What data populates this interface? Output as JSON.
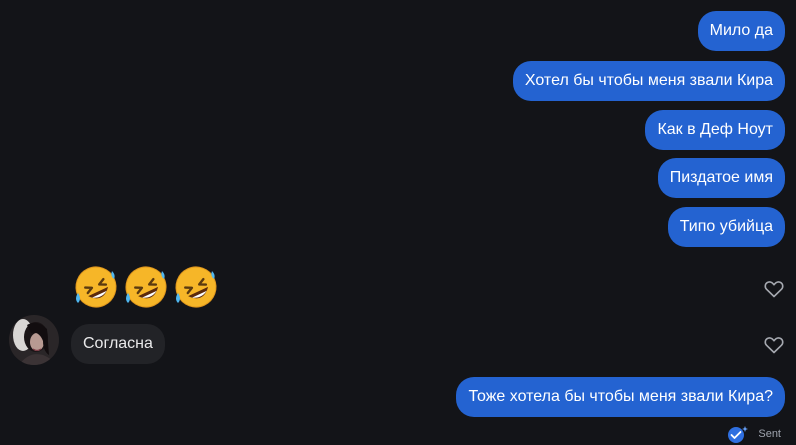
{
  "outgoing_messages": [
    {
      "text": "Мило да"
    },
    {
      "text": "Хотел бы чтобы меня звали Кира"
    },
    {
      "text": "Как в Деф Ноут"
    },
    {
      "text": "Пиздатое имя"
    },
    {
      "text": "Типо убийца"
    }
  ],
  "reaction_message": {
    "emoji_count": 3,
    "emoji_name": "rolling-on-the-floor-laughing"
  },
  "incoming_message": {
    "text": "Согласна"
  },
  "last_outgoing": {
    "text": "Тоже хотела бы чтобы меня звали Кира?"
  },
  "status": {
    "label": "Sent",
    "icon": "sent-check-icon"
  },
  "colors": {
    "background": "#131418",
    "outgoing_bubble": "#2463d1",
    "incoming_bubble": "#222327",
    "heart_stroke": "#a6a9b0"
  }
}
